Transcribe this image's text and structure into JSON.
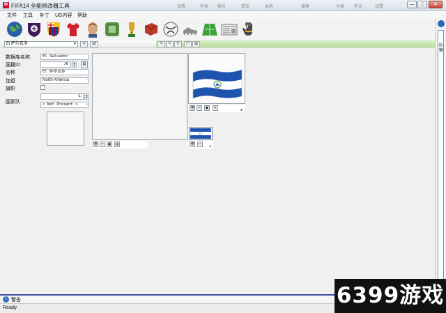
{
  "window": {
    "app_icon": "M",
    "title": "FIFA14 全能修改器工具",
    "top_ghost": [
      "设置",
      "字体",
      "账号",
      "提交",
      "本机",
      "搜索",
      "分类",
      "中文",
      "设置"
    ],
    "buttons": {
      "minimize": "—",
      "restore": "□",
      "close": "✕"
    }
  },
  "menu": [
    "文件",
    "工具",
    "补丁",
    "UG内容",
    "帮助"
  ],
  "toolbar": {
    "icons": [
      {
        "name": "globe-icon",
        "color": "#2a5fa8"
      },
      {
        "name": "premier-league-icon",
        "color": "#3d195b"
      },
      {
        "name": "barcelona-crest-icon",
        "color": "#a50044"
      },
      {
        "name": "jersey-icon",
        "color": "#d1202e"
      },
      {
        "name": "player-face-icon",
        "color": "#d9a57a"
      },
      {
        "name": "stadium-icon",
        "color": "#5a8f45"
      },
      {
        "name": "trophy-icon",
        "color": "#d6a824"
      },
      {
        "name": "kit-bag-icon",
        "color": "#c03a2b"
      },
      {
        "name": "ball-icon",
        "color": "#e8e8e8"
      },
      {
        "name": "boots-icon",
        "color": "#8c8c8c"
      },
      {
        "name": "pitch-icon",
        "color": "#3aa33a"
      },
      {
        "name": "newspaper-icon",
        "color": "#b9b9b9"
      },
      {
        "name": "goalkeeper-gloves-icon",
        "color": "#4b4b4b"
      }
    ]
  },
  "selector": {
    "team": "El 萨尔瓦多",
    "refresh": "⟲",
    "search": "a9",
    "actions": [
      "✎",
      "✎",
      "✎",
      "▢",
      "▤"
    ]
  },
  "form": {
    "labels": {
      "db_name": "数据库名称",
      "country_id": "国籍ID",
      "name": "名称",
      "confederation": "加盟",
      "flag": "旗帜",
      "national_team": "国家队"
    },
    "db_name": "El Salvador",
    "country_id": "76",
    "name": "El 萨尔瓦多",
    "confederation": "North America",
    "flag_value": "-1",
    "national_team": "< Not Present >"
  },
  "flag_colors": {
    "blue": "#1e54b0",
    "white": "#ffffff",
    "emblem": "#6f9a55"
  },
  "panels": {
    "main_tools": [
      "👁",
      "✂",
      "▣",
      "▤"
    ],
    "flag_tools": [
      "👁",
      "✂",
      "▣",
      "✕"
    ],
    "small_flag_tools": [
      "👁",
      "✂"
    ],
    "expand": "▸"
  },
  "scrollbar": {
    "label": "队徽"
  },
  "alert": {
    "icon": "i",
    "text": "警告"
  },
  "status": "Ready",
  "watermark": "6399游戏"
}
